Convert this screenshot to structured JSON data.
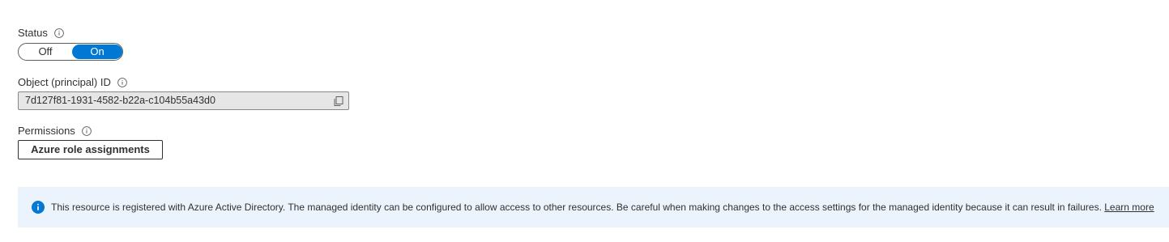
{
  "status": {
    "label": "Status",
    "off_label": "Off",
    "on_label": "On",
    "selected": "On"
  },
  "object_id": {
    "label": "Object (principal) ID",
    "value": "7d127f81-1931-4582-b22a-c104b55a43d0"
  },
  "permissions": {
    "label": "Permissions",
    "button_label": "Azure role assignments"
  },
  "banner": {
    "text": "This resource is registered with Azure Active Directory. The managed identity can be configured to allow access to other resources. Be careful when making changes to the access settings for the managed identity because it can result in failures.",
    "link_label": "Learn more"
  },
  "colors": {
    "accent": "#0078d4",
    "banner_background": "#ebf3fc",
    "readonly_field_background": "#e6e6e6"
  },
  "icons": {
    "info": "info-circle-icon",
    "copy": "copy-icon",
    "banner_info": "info-filled-icon"
  }
}
